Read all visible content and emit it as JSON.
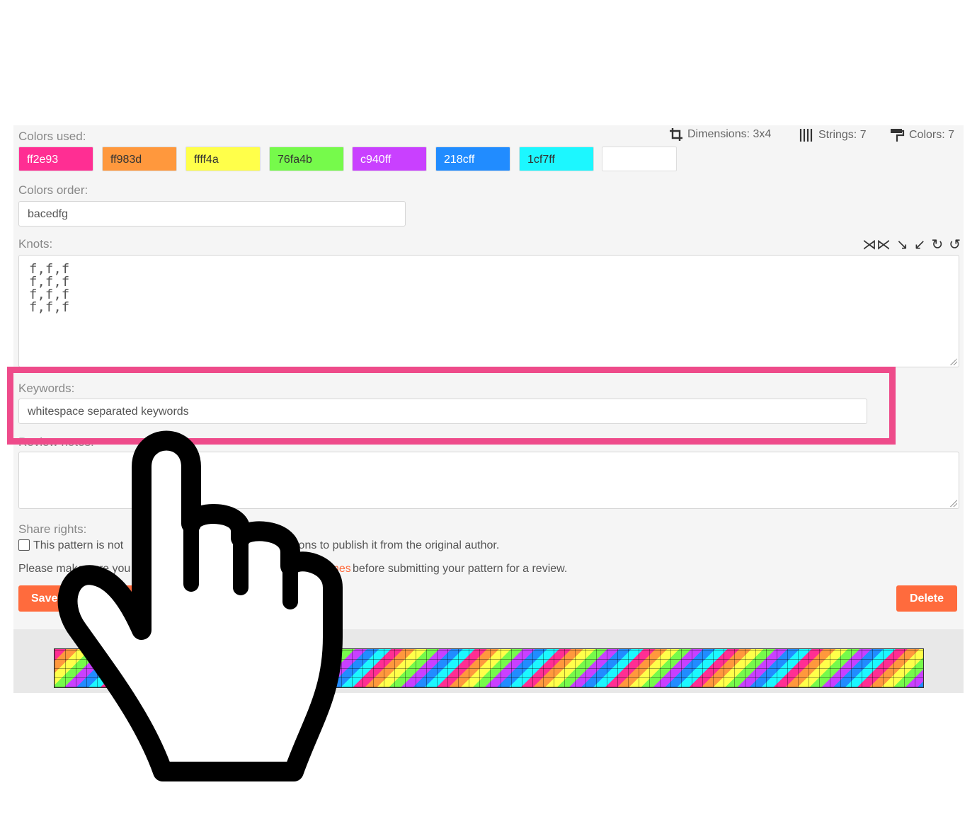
{
  "colors_label": "Colors used:",
  "swatches": [
    {
      "hex": "ff2e93",
      "color": "#ff2e93"
    },
    {
      "hex": "ff983d",
      "color": "#ff983d"
    },
    {
      "hex": "ffff4a",
      "color": "#ffff4a"
    },
    {
      "hex": "76fa4b",
      "color": "#76fa4b"
    },
    {
      "hex": "c940ff",
      "color": "#c940ff"
    },
    {
      "hex": "218cff",
      "color": "#218cff"
    },
    {
      "hex": "1cf7ff",
      "color": "#1cf7ff"
    },
    {
      "hex": "",
      "color": "#ffffff"
    }
  ],
  "stats": {
    "dimensions": "Dimensions: 3x4",
    "strings": "Strings: 7",
    "colors": "Colors: 7"
  },
  "colors_order": {
    "label": "Colors order:",
    "value": "bacedfg"
  },
  "knots": {
    "label": "Knots:",
    "value": "f,f,f\nf,f,f\nf,f,f\nf,f,f"
  },
  "keywords": {
    "label": "Keywords:",
    "placeholder": "whitespace separated keywords"
  },
  "review_notes": {
    "label": "Review notes:"
  },
  "share_rights": {
    "label": "Share rights:",
    "checkbox_text_start": "This pattern is not",
    "checkbox_text_end": "sions to publish it from the original author."
  },
  "guidelines": {
    "text_start": "Please make sure you",
    "link_fragment": "nes",
    "text_end": "before submitting your pattern for a review."
  },
  "buttons": {
    "save": "Save",
    "delete": "Delete"
  },
  "accent_color": "#ff6b3d",
  "highlight_color": "#ee4b8a"
}
